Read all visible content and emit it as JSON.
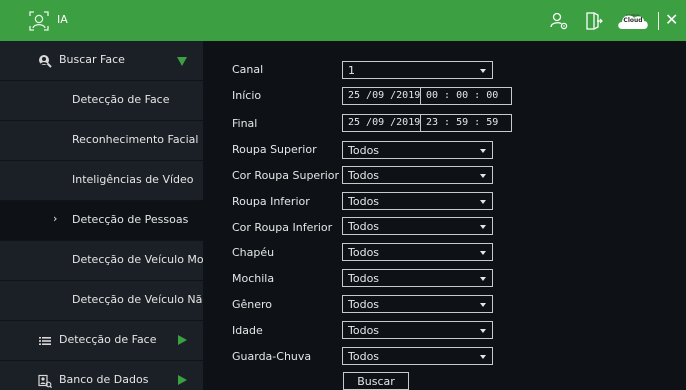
{
  "app": {
    "title": "IA",
    "cloud_badge_text": "Cloud",
    "cloud_badge_small": "Intelbras",
    "colors": {
      "accent": "#3ca043",
      "sidebar_bg": "#1b2026",
      "main_bg": "#0e1217"
    },
    "icons": [
      "face-scan-icon",
      "user-settings-icon",
      "exit-icon",
      "cloud-icon",
      "close-icon"
    ]
  },
  "sidebar": {
    "groups": [
      {
        "label": "Buscar Face",
        "icon": "face-search-icon",
        "expanded": true
      },
      {
        "label": "Detecção de Face",
        "icon": "list-icon",
        "expanded": false
      },
      {
        "label": "Banco de Dados",
        "icon": "database-icon",
        "expanded": false
      }
    ],
    "items": [
      {
        "label": "Detecção de Face"
      },
      {
        "label": "Reconhecimento Facial"
      },
      {
        "label": "Inteligências de Vídeo"
      },
      {
        "label": "Detecção de Pessoas",
        "active": true,
        "marker": "›"
      },
      {
        "label": "Detecção de Veículo Mo..."
      },
      {
        "label": "Detecção de Veículo Nã..."
      }
    ]
  },
  "form": {
    "canal": {
      "label": "Canal",
      "value": "1"
    },
    "inicio": {
      "label": "Início",
      "date": "25 /09 /2019",
      "time": "00 : 00 : 00"
    },
    "final": {
      "label": "Final",
      "date": "25 /09 /2019",
      "time": "23 : 59 : 59"
    },
    "fields": [
      {
        "label": "Roupa Superior",
        "value": "Todos"
      },
      {
        "label": "Cor Roupa Superior",
        "value": "Todos"
      },
      {
        "label": "Roupa Inferior",
        "value": "Todos"
      },
      {
        "label": "Cor Roupa Inferior",
        "value": "Todos"
      },
      {
        "label": "Chapéu",
        "value": "Todos"
      },
      {
        "label": "Mochila",
        "value": "Todos"
      },
      {
        "label": "Gênero",
        "value": "Todos"
      },
      {
        "label": "Idade",
        "value": "Todos"
      },
      {
        "label": "Guarda-Chuva",
        "value": "Todos"
      }
    ],
    "search_button": "Buscar"
  }
}
